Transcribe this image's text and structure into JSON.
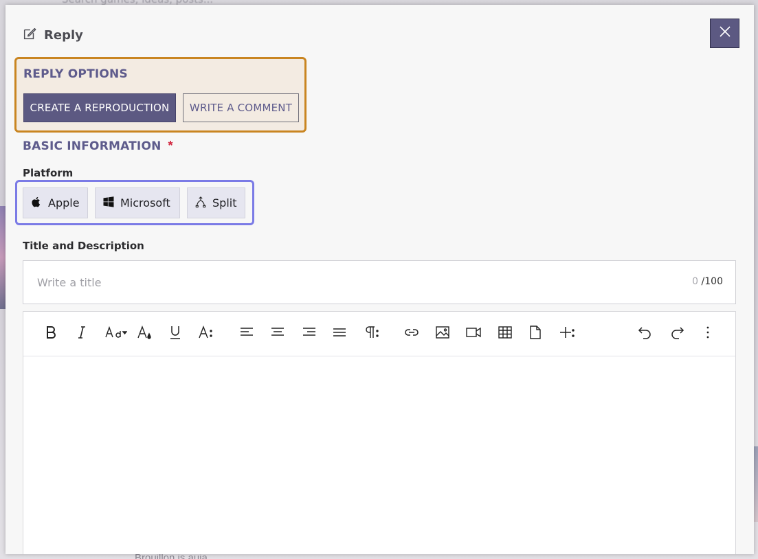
{
  "background": {
    "search_placeholder": "Search games, ideas, posts...",
    "bottom_text": "Brouillon is auja"
  },
  "modal": {
    "title": "Reply",
    "header_icon": "edit-icon",
    "close_icon": "close-icon"
  },
  "reply_options": {
    "heading": "REPLY OPTIONS",
    "primary_label": "CREATE A REPRODUCTION",
    "secondary_label": "WRITE A COMMENT"
  },
  "basic_information": {
    "heading": "BASIC INFORMATION",
    "required_marker": "*"
  },
  "platform": {
    "label": "Platform",
    "options": [
      {
        "label": "Apple",
        "icon": "apple-icon"
      },
      {
        "label": "Microsoft",
        "icon": "windows-icon"
      },
      {
        "label": "Split",
        "icon": "split-icon"
      }
    ]
  },
  "title_description": {
    "label": "Title and Description",
    "placeholder": "Write a title",
    "count_current": "0",
    "count_max": "/100"
  },
  "toolbar": {
    "tools": [
      "bold-icon",
      "italic-icon",
      "font-size-icon",
      "text-color-icon",
      "underline-icon",
      "text-format-more-icon",
      "align-left-icon",
      "align-center-icon",
      "align-right-icon",
      "justify-icon",
      "paragraph-more-icon",
      "link-icon",
      "image-icon",
      "video-icon",
      "table-icon",
      "file-icon",
      "insert-more-icon",
      "undo-icon",
      "redo-icon",
      "more-vertical-icon"
    ]
  },
  "colors": {
    "accent": "#5c5982",
    "reply_options_border": "#c98521",
    "platform_border": "#7b7be6",
    "required": "#d1253e"
  }
}
